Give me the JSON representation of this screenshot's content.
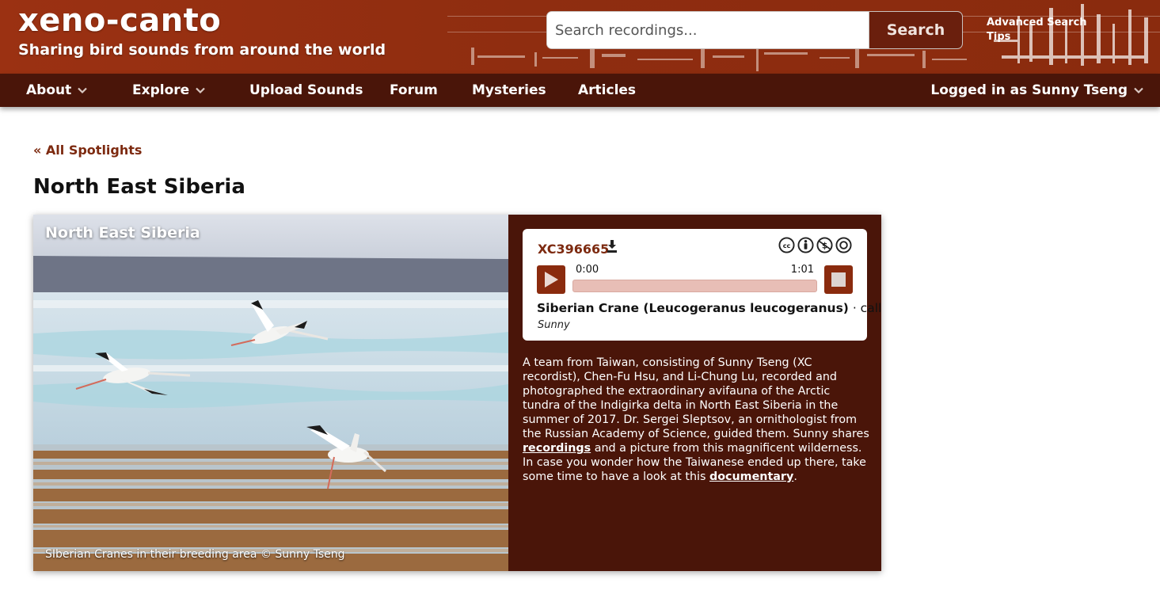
{
  "header": {
    "site_title": "xeno-canto",
    "tagline": "Sharing bird sounds from around the world",
    "search_placeholder": "Search recordings...",
    "search_button": "Search",
    "advanced_search": "Advanced Search",
    "tips": "Tips"
  },
  "nav": {
    "items": [
      {
        "label": "About",
        "dropdown": true
      },
      {
        "label": "Explore",
        "dropdown": true
      },
      {
        "label": "Upload Sounds",
        "dropdown": false
      },
      {
        "label": "Forum",
        "dropdown": false
      },
      {
        "label": "Mysteries",
        "dropdown": false
      },
      {
        "label": "Articles",
        "dropdown": false
      }
    ],
    "user_label": "Logged in as Sunny Tseng"
  },
  "main": {
    "back_link": "« All Spotlights",
    "page_title": "North East Siberia"
  },
  "spotlight": {
    "photo_title": "North East Siberia",
    "photo_caption": "SIberian Cranes in their breeding area © Sunny Tseng",
    "player": {
      "recording_id": "XC396665",
      "time_current": "0:00",
      "time_total": "1:01",
      "progress_fraction": 0,
      "species": "Siberian Crane (Leucogeranus leucogeranus)",
      "separator": " · ",
      "sound_type": "call",
      "recordist": "Sunny",
      "license_icons": [
        "cc-icon",
        "by-icon",
        "nc-icon",
        "sa-icon"
      ]
    },
    "description": {
      "part1": "A team from Taiwan, consisting of Sunny Tseng (XC recordist), Chen-Fu Hsu, and Li-Chung Lu, recorded and photographed the extraordinary avifauna of the Arctic tundra of the Indigirka delta in North East Siberia in the summer of 2017. Dr. Sergei Sleptsov, an ornithologist from the Russian Academy of Science, guided them. Sunny shares ",
      "link1": "recordings",
      "part2": " and a picture from this magnificent wilderness. In case you wonder how the Taiwanese ended up there, take some time to have a look at this ",
      "link2": "documentary",
      "part3": "."
    }
  },
  "colors": {
    "header_bg": "#8f2d10",
    "nav_bg": "#4a1509",
    "accent": "#7d2a10",
    "panel_bg": "#4a1509",
    "progress_track": "#e8beb6"
  }
}
